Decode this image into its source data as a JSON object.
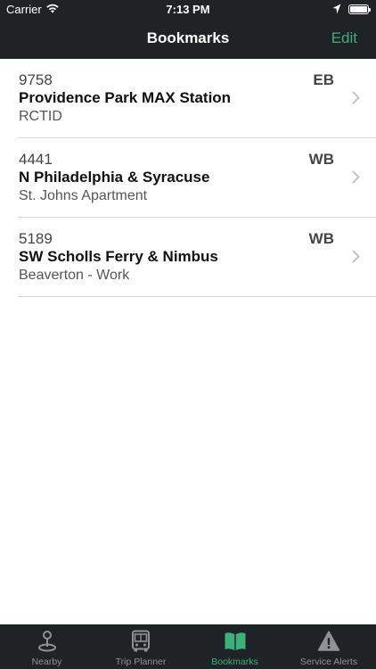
{
  "status": {
    "carrier": "Carrier",
    "time": "7:13 PM"
  },
  "nav": {
    "title": "Bookmarks",
    "edit_label": "Edit"
  },
  "bookmarks": [
    {
      "stop_id": "9758",
      "direction": "EB",
      "name": "Providence Park MAX Station",
      "description": "RCTID"
    },
    {
      "stop_id": "4441",
      "direction": "WB",
      "name": "N Philadelphia & Syracuse",
      "description": "St. Johns Apartment"
    },
    {
      "stop_id": "5189",
      "direction": "WB",
      "name": "SW Scholls Ferry & Nimbus",
      "description": "Beaverton - Work"
    }
  ],
  "tabs": [
    {
      "label": "Nearby",
      "icon": "map-pin-icon",
      "active": false
    },
    {
      "label": "Trip Planner",
      "icon": "bus-icon",
      "active": false
    },
    {
      "label": "Bookmarks",
      "icon": "book-icon",
      "active": true
    },
    {
      "label": "Service Alerts",
      "icon": "alert-icon",
      "active": false
    }
  ],
  "colors": {
    "bar_background": "#1f2326",
    "accent": "#3cb07a",
    "inactive_tab": "#8e9296"
  }
}
